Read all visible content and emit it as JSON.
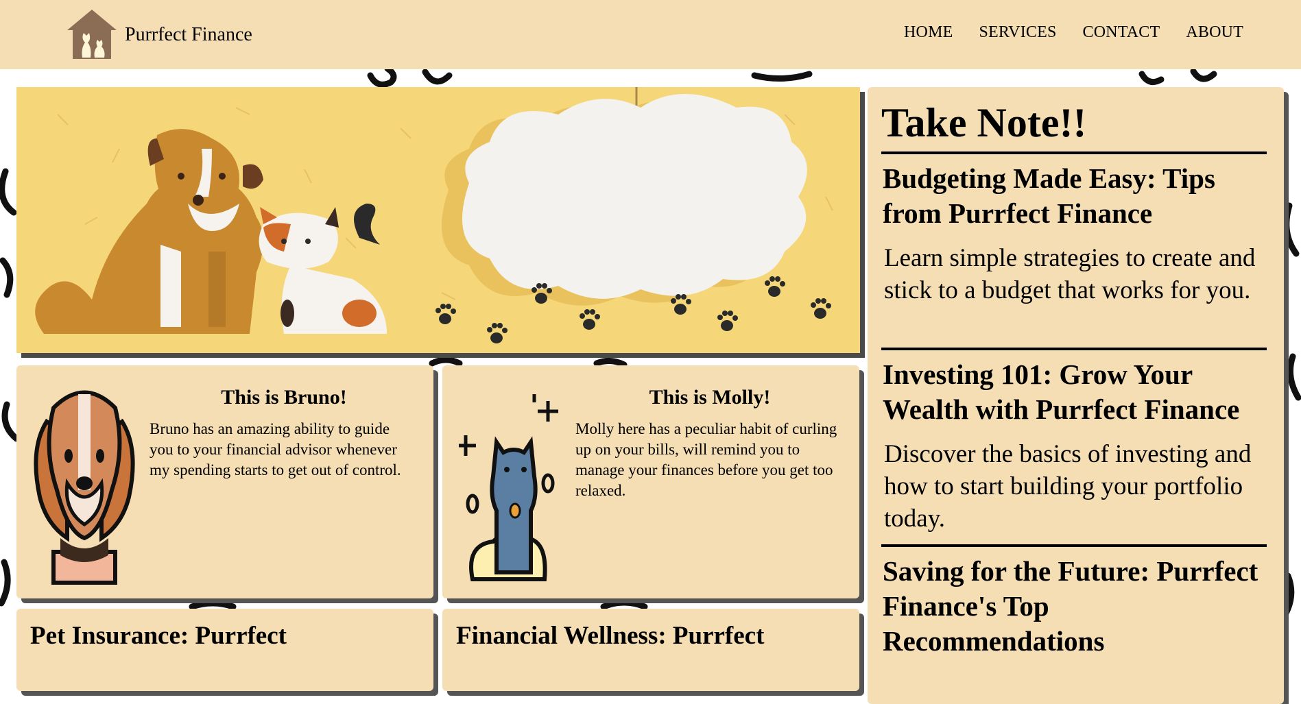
{
  "brand": {
    "name": "Purrfect Finance",
    "logo_icon": "house-pets-logo"
  },
  "nav": {
    "items": [
      "HOME",
      "SERVICES",
      "CONTACT",
      "ABOUT"
    ]
  },
  "hero": {
    "image": "dog-cat-cloud-banner",
    "colors": {
      "background": "#f5d77a",
      "cloud": "#f4f2ee"
    }
  },
  "pets": [
    {
      "title": "This is Bruno!",
      "description": "Bruno has an amazing ability to guide you to your financial advisor whenever my spending starts to get out of control.",
      "icon": "beagle-dog-icon"
    },
    {
      "title": "This is Molly!",
      "description": "Molly here has a peculiar habit of curling up on your bills, will remind you to manage your finances before you get too relaxed.",
      "icon": "blue-cat-icon"
    }
  ],
  "articles": [
    {
      "title": "Pet Insurance: Purrfect"
    },
    {
      "title": "Financial Wellness: Purrfect"
    }
  ],
  "sidebar": {
    "title": "Take Note!!",
    "notes": [
      {
        "heading": "Budgeting Made Easy: Tips from Purrfect Finance",
        "text": "Learn simple strategies to create and stick to a budget that works for you."
      },
      {
        "heading": "Investing 101: Grow Your Wealth with Purrfect Finance",
        "text": "Discover the basics of investing and how to start building your portfolio today."
      },
      {
        "heading": "Saving for the Future: Purrfect Finance's Top Recommendations",
        "text": ""
      }
    ]
  },
  "colors": {
    "panel": "#f5deb3",
    "shadow": "#555555",
    "text": "#000000"
  }
}
